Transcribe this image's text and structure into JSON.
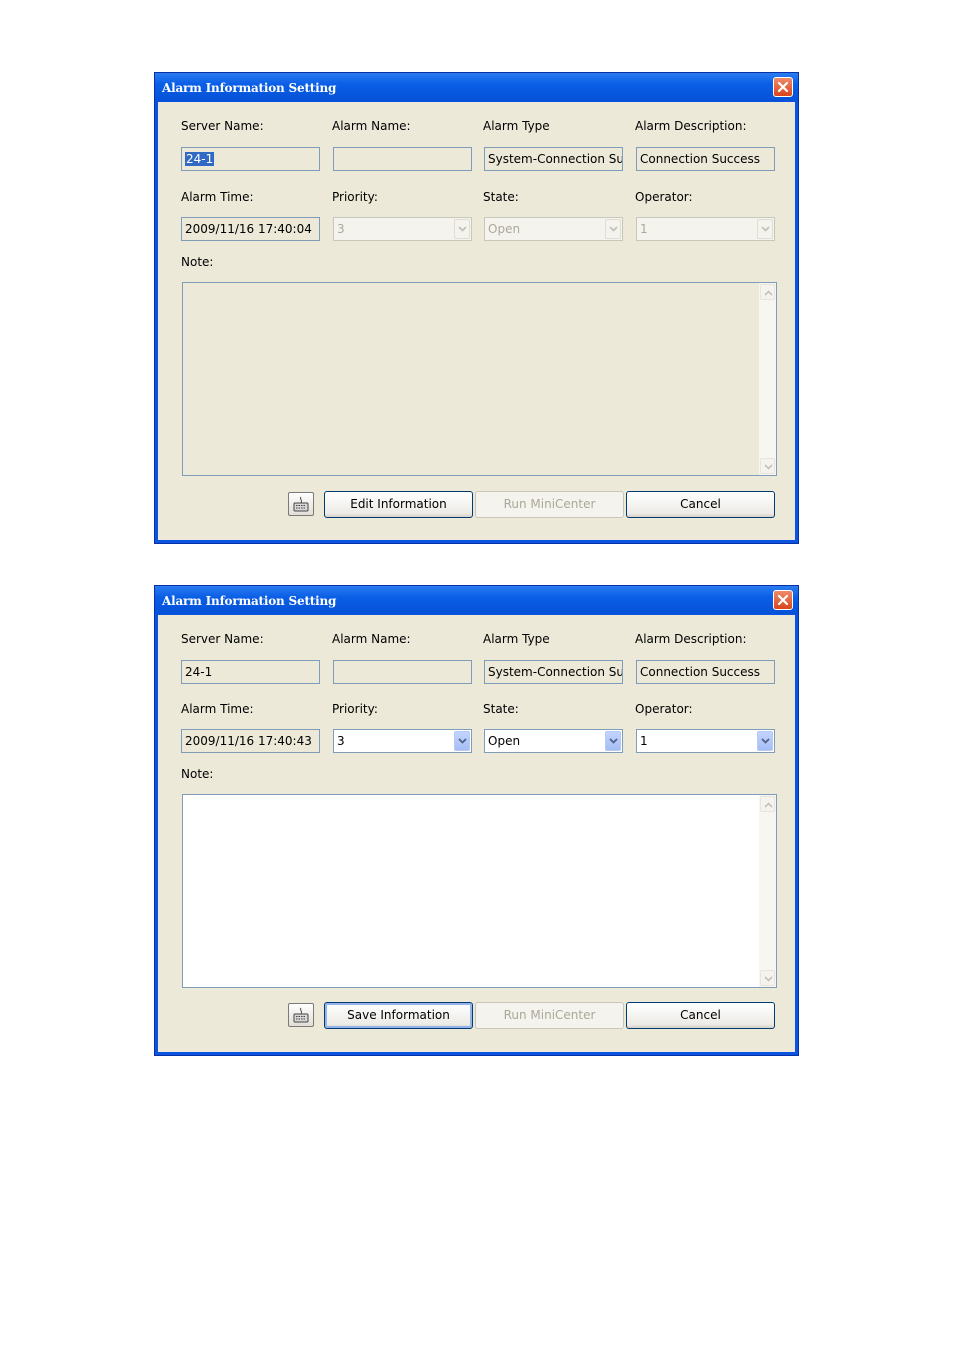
{
  "dialogs": [
    {
      "title": "Alarm Information Setting",
      "labels": {
        "server_name": "Server Name:",
        "alarm_name": "Alarm Name:",
        "alarm_type": "Alarm Type",
        "alarm_description": "Alarm Description:",
        "alarm_time": "Alarm Time:",
        "priority": "Priority:",
        "state": "State:",
        "operator": "Operator:",
        "note": "Note:"
      },
      "values": {
        "server_name": "24-1",
        "alarm_name": "",
        "alarm_type": "System-Connection Su",
        "alarm_description": "Connection Success",
        "alarm_time": "2009/11/16 17:40:04",
        "priority": "3",
        "state": "Open",
        "operator": "1",
        "note": ""
      },
      "buttons": {
        "primary": "Edit Information",
        "run_minicenter": "Run MiniCenter",
        "cancel": "Cancel"
      },
      "editable": false
    },
    {
      "title": "Alarm Information Setting",
      "labels": {
        "server_name": "Server Name:",
        "alarm_name": "Alarm Name:",
        "alarm_type": "Alarm Type",
        "alarm_description": "Alarm Description:",
        "alarm_time": "Alarm Time:",
        "priority": "Priority:",
        "state": "State:",
        "operator": "Operator:",
        "note": "Note:"
      },
      "values": {
        "server_name": "24-1",
        "alarm_name": "",
        "alarm_type": "System-Connection Su",
        "alarm_description": "Connection Success",
        "alarm_time": "2009/11/16 17:40:43",
        "priority": "3",
        "state": "Open",
        "operator": "1",
        "note": ""
      },
      "buttons": {
        "primary": "Save Information",
        "run_minicenter": "Run MiniCenter",
        "cancel": "Cancel"
      },
      "editable": true
    }
  ],
  "icons": {
    "close": "close-icon",
    "dropdown": "chevron-down-icon",
    "keyboard": "keyboard-icon",
    "scroll_up": "scroll-up-icon",
    "scroll_down": "scroll-down-icon"
  },
  "colors": {
    "titlebar": "#0a5ee6",
    "client": "#ece9d8",
    "selection": "#316ac5",
    "close": "#d8451c"
  }
}
